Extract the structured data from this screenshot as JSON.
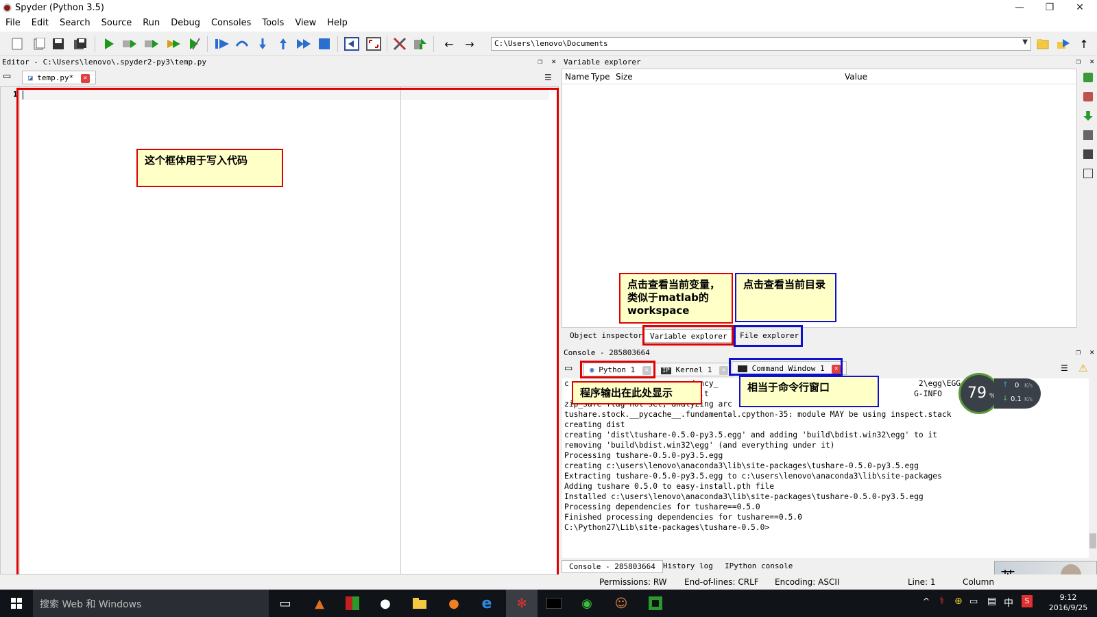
{
  "window": {
    "title": "Spyder (Python 3.5)",
    "minimize": "—",
    "restore": "❐",
    "close": "✕"
  },
  "menu": [
    "File",
    "Edit",
    "Search",
    "Source",
    "Run",
    "Debug",
    "Consoles",
    "Tools",
    "View",
    "Help"
  ],
  "toolbar": {
    "path": "C:\\Users\\lenovo\\Documents"
  },
  "editor": {
    "header": "Editor - C:\\Users\\lenovo\\.spyder2-py3\\temp.py",
    "tab_label": "temp.py*",
    "line_number": "1",
    "annotation": "这个框体用于写入代码"
  },
  "variable_explorer": {
    "header": "Variable explorer",
    "columns": [
      "Name",
      "Type",
      "Size",
      "Value"
    ],
    "annotation_vars": "点击查看当前变量，类似于matlab的workspace",
    "annotation_files": "点击查看当前目录"
  },
  "right_tabs": [
    "Object inspector",
    "Variable explorer",
    "File explorer"
  ],
  "console": {
    "header": "Console - 285803664",
    "tabs": [
      "Python 1",
      "Kernel 1",
      "Command Window 1"
    ],
    "annotation_output": "程序输出在此处显示",
    "annotation_cmd": "相当于命令行窗口",
    "lines": [
      "c                        endency_                                           2\\egg\\EGG-INFO",
      "                        level.t                                            G-INFO",
      "zip_safe flag not set; analyzing arc",
      "tushare.stock.__pycache__.fundamental.cpython-35: module MAY be using inspect.stack",
      "creating dist",
      "creating 'dist\\tushare-0.5.0-py3.5.egg' and adding 'build\\bdist.win32\\egg' to it",
      "removing 'build\\bdist.win32\\egg' (and everything under it)",
      "Processing tushare-0.5.0-py3.5.egg",
      "creating c:\\users\\lenovo\\anaconda3\\lib\\site-packages\\tushare-0.5.0-py3.5.egg",
      "Extracting tushare-0.5.0-py3.5.egg to c:\\users\\lenovo\\anaconda3\\lib\\site-packages",
      "Adding tushare 0.5.0 to easy-install.pth file",
      "",
      "Installed c:\\users\\lenovo\\anaconda3\\lib\\site-packages\\tushare-0.5.0-py3.5.egg",
      "Processing dependencies for tushare==0.5.0",
      "Finished processing dependencies for tushare==0.5.0",
      "",
      "C:\\Python27\\Lib\\site-packages\\tushare-0.5.0>"
    ],
    "bottom_tabs": [
      "Console - 285803664",
      "History log",
      "IPython console"
    ]
  },
  "net": {
    "percent": "79",
    "unit": "%",
    "up": "0",
    "down": "0.1",
    "rate_unit": "K/s"
  },
  "status": {
    "permissions": "Permissions: RW",
    "eol": "End-of-lines: CRLF",
    "encoding": "Encoding: ASCII",
    "line": "Line: 1",
    "column": "Column"
  },
  "taskbar": {
    "search_placeholder": "搜索 Web 和 Windows",
    "time": "9:12",
    "date": "2016/9/25",
    "ime": "中"
  },
  "colors": {
    "annotation_red": "#e00000",
    "annotation_blue": "#1010d0",
    "note_bg": "#ffffc8"
  }
}
